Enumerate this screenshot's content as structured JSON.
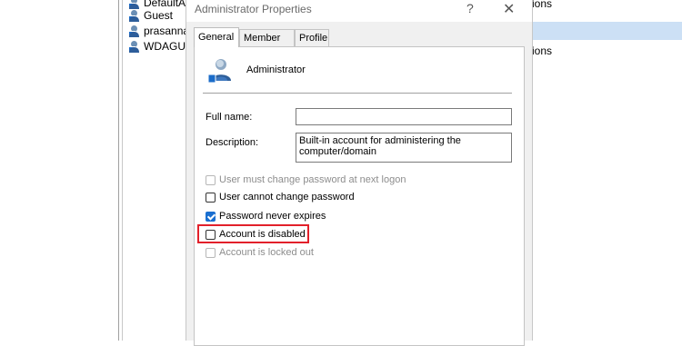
{
  "background_list": {
    "items": [
      {
        "label": "DefaultAc"
      },
      {
        "label": "Guest"
      },
      {
        "label": "prasanna"
      },
      {
        "label": "WDAGUti"
      }
    ],
    "descriptions": [
      "ions",
      "ions"
    ],
    "selected_color": "#cce0f5"
  },
  "dialog": {
    "title": "Administrator Properties",
    "help_glyph": "?",
    "close_glyph": "✕",
    "tabs": [
      {
        "label": "General",
        "active": true
      },
      {
        "label": "Member Of",
        "active": false
      },
      {
        "label": "Profile",
        "active": false
      }
    ],
    "user_name": "Administrator",
    "full_name": {
      "label": "Full name:",
      "value": ""
    },
    "description": {
      "label": "Description:",
      "value": "Built-in account for administering the computer/domain"
    },
    "checkboxes": [
      {
        "label": "User must change password at next logon",
        "checked": false,
        "enabled": false
      },
      {
        "label": "User cannot change password",
        "checked": false,
        "enabled": true
      },
      {
        "label": "Password never expires",
        "checked": true,
        "enabled": true
      },
      {
        "label": "Account is disabled",
        "checked": false,
        "enabled": true
      },
      {
        "label": "Account is locked out",
        "checked": false,
        "enabled": false
      }
    ],
    "highlight_color": "#e2202a",
    "check_color": "#1a6fd0"
  }
}
